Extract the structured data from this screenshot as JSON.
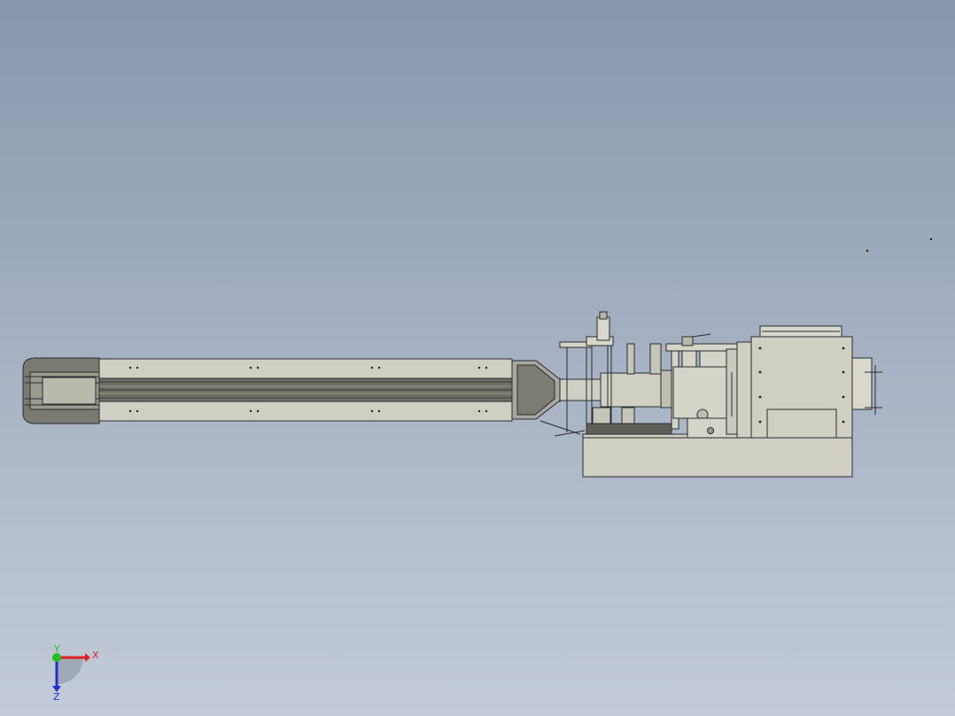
{
  "viewport": {
    "background_top": "#8797ac",
    "background_bottom": "#c3cbd8"
  },
  "model": {
    "kind": "cad-assembly-top-view",
    "body_color": "#cfcfc3",
    "dark_color": "#6e6e66",
    "outline_color": "#2b2b2b"
  },
  "triad": {
    "x_label": "X",
    "y_label": "Y",
    "z_label": "Z",
    "x_color": "#e02020",
    "y_color": "#20c020",
    "z_color": "#2030d0"
  }
}
